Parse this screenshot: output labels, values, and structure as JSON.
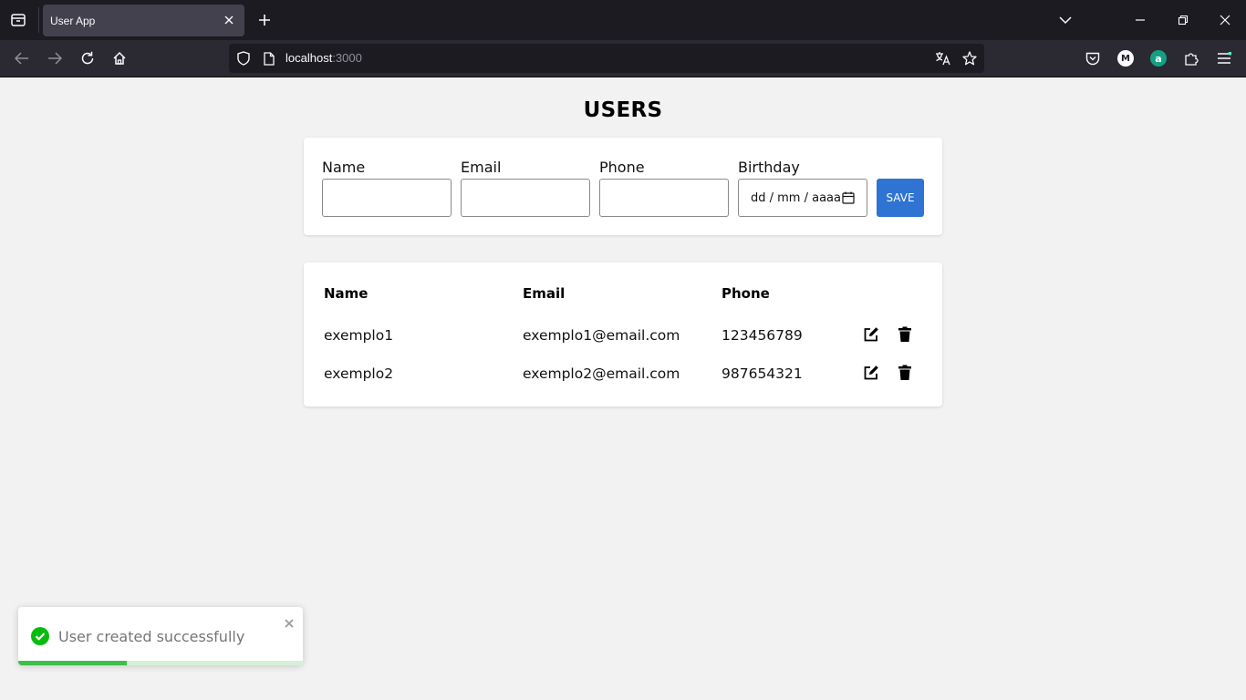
{
  "browser": {
    "tab_title": "User App",
    "url_host": "localhost",
    "url_port": ":3000",
    "profile_badge": "M",
    "addon_badge": "a"
  },
  "page": {
    "title": "USERS"
  },
  "form": {
    "name_label": "Name",
    "email_label": "Email",
    "phone_label": "Phone",
    "birthday_label": "Birthday",
    "birthday_placeholder": "dd / mm / aaaa",
    "name_value": "",
    "email_value": "",
    "phone_value": "",
    "save_label": "SAVE"
  },
  "table": {
    "headers": [
      "Name",
      "Email",
      "Phone"
    ],
    "rows": [
      {
        "name": "exemplo1",
        "email": "exemplo1@email.com",
        "phone": "123456789"
      },
      {
        "name": "exemplo2",
        "email": "exemplo2@email.com",
        "phone": "987654321"
      }
    ]
  },
  "toast": {
    "message": "User created successfully",
    "progress": 0.38
  },
  "colors": {
    "accent": "#2f73d3",
    "success": "#3fbe4a",
    "chrome_dark": "#1c1b22"
  },
  "icons": {
    "edit": "edit-icon",
    "delete": "trash-icon",
    "success": "check-circle-icon",
    "close": "close-icon"
  }
}
